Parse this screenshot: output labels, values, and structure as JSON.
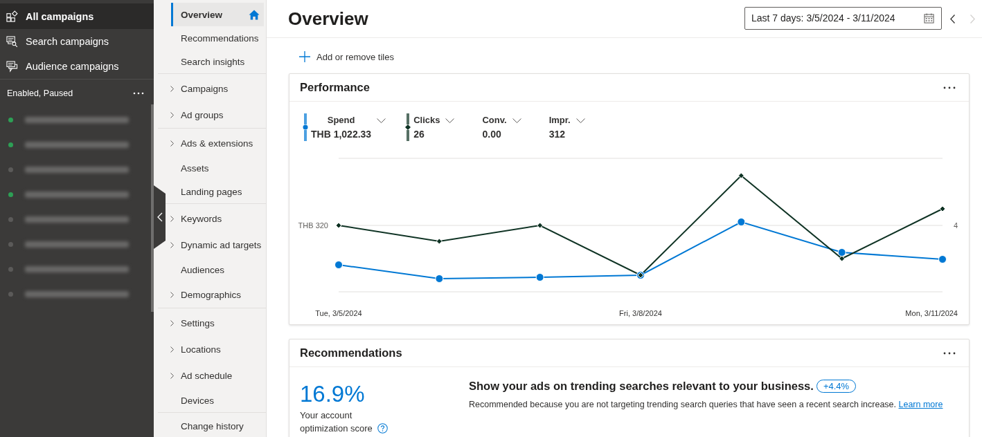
{
  "sidebar": {
    "items": [
      {
        "label": "All campaigns",
        "selected": true
      },
      {
        "label": "Search campaigns",
        "selected": false
      },
      {
        "label": "Audience campaigns",
        "selected": false
      }
    ],
    "filter": {
      "label": "Enabled, Paused"
    },
    "campaigns": [
      {
        "color": "#2d9f55"
      },
      {
        "color": "#2d9f55"
      },
      {
        "color": "#5b5a59"
      },
      {
        "color": "#2d9f55"
      },
      {
        "color": "#5b5a59"
      },
      {
        "color": "#5b5a59"
      },
      {
        "color": "#5b5a59"
      },
      {
        "color": "#5b5a59"
      }
    ]
  },
  "nav": {
    "sections": [
      {
        "items": [
          {
            "label": "Overview",
            "kind": "page",
            "selected": true,
            "home": true
          },
          {
            "label": "Recommendations",
            "kind": "page",
            "selected": false,
            "home": false
          },
          {
            "label": "Search insights",
            "kind": "page",
            "selected": false,
            "home": false
          }
        ]
      },
      {
        "items": [
          {
            "label": "Campaigns",
            "kind": "group",
            "selected": false,
            "home": false
          },
          {
            "label": "Ad groups",
            "kind": "group",
            "selected": false,
            "home": false
          }
        ]
      },
      {
        "items": [
          {
            "label": "Ads & extensions",
            "kind": "group",
            "selected": false,
            "home": false
          },
          {
            "label": "Assets",
            "kind": "page",
            "selected": false,
            "home": false
          },
          {
            "label": "Landing pages",
            "kind": "page",
            "selected": false,
            "home": false
          }
        ]
      },
      {
        "items": [
          {
            "label": "Keywords",
            "kind": "group",
            "selected": false,
            "home": false
          },
          {
            "label": "Dynamic ad targets",
            "kind": "group",
            "selected": false,
            "home": false
          },
          {
            "label": "Audiences",
            "kind": "page",
            "selected": false,
            "home": false
          },
          {
            "label": "Demographics",
            "kind": "group",
            "selected": false,
            "home": false
          }
        ]
      },
      {
        "items": [
          {
            "label": "Settings",
            "kind": "group",
            "selected": false,
            "home": false
          },
          {
            "label": "Locations",
            "kind": "group",
            "selected": false,
            "home": false
          },
          {
            "label": "Ad schedule",
            "kind": "group",
            "selected": false,
            "home": false
          },
          {
            "label": "Devices",
            "kind": "page",
            "selected": false,
            "home": false
          }
        ]
      },
      {
        "items": [
          {
            "label": "Change history",
            "kind": "page",
            "selected": false,
            "home": false
          }
        ]
      }
    ]
  },
  "header": {
    "title": "Overview",
    "date_range": "Last 7 days: 3/5/2024 - 3/11/2024",
    "date_steps": [
      {
        "kind": "previous",
        "disabled": false
      },
      {
        "kind": "next",
        "disabled": true
      }
    ]
  },
  "add_tiles": {
    "label": "Add or remove tiles"
  },
  "performance": {
    "title": "Performance",
    "metrics": [
      {
        "label": "Spend",
        "value": "THB 1,022.33",
        "selected": true
      },
      {
        "label": "Clicks",
        "value": "26",
        "selected": true
      },
      {
        "label": "Conv.",
        "value": "0.00",
        "selected": false
      },
      {
        "label": "Impr.",
        "value": "312",
        "selected": false
      }
    ],
    "chart": {
      "left_axis_label": "THB 320",
      "right_axis_label": "4",
      "date_labels": [
        "Tue, 3/5/2024",
        "Fri, 3/8/2024",
        "Mon, 3/11/2024"
      ]
    }
  },
  "recommendations": {
    "title": "Recommendations",
    "score": "16.9%",
    "score_label": "Your account optimization score",
    "title_text": "Show your ads on trending searches relevant to your business.",
    "badge": "+4.4%",
    "description": "Recommended because you are not targeting trending search queries that have seen a recent search increase.",
    "link": "Learn more"
  }
}
